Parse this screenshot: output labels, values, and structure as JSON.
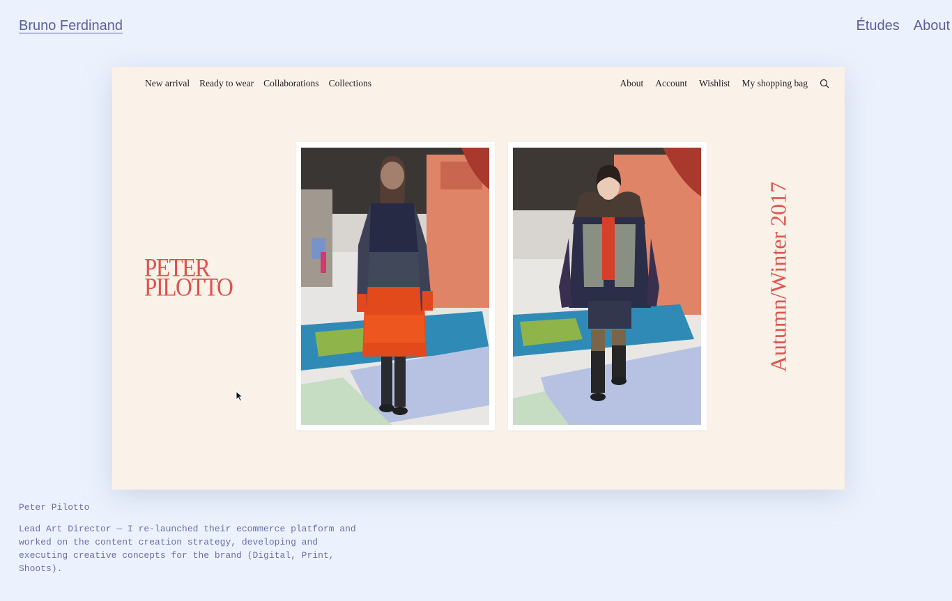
{
  "site": {
    "title": "Bruno Ferdinand",
    "nav": [
      "Études",
      "About"
    ]
  },
  "preview": {
    "shop_nav_left": [
      "New arrival",
      "Ready to wear",
      "Collaborations",
      "Collections"
    ],
    "shop_nav_right": [
      "About",
      "Account",
      "Wishlist",
      "My shopping bag"
    ],
    "brand_logo_lines": [
      "PETER",
      "PILOTTO"
    ],
    "season": "Autumn/Winter 2017",
    "photos": [
      {
        "icon": "runway-photo-1"
      },
      {
        "icon": "runway-photo-2"
      }
    ]
  },
  "project": {
    "title": "Peter Pilotto",
    "description": "Lead Art Director — I re-launched their ecommerce platform and worked on the content creation strategy, developing and executing creative concepts for the brand (Digital, Print, Shoots)."
  },
  "colors": {
    "background": "#ecf2fd",
    "link": "#5a5f9e",
    "preview_bg": "#faf1e8",
    "brand_red": "#e0524d",
    "mono_text": "#6870a6"
  }
}
